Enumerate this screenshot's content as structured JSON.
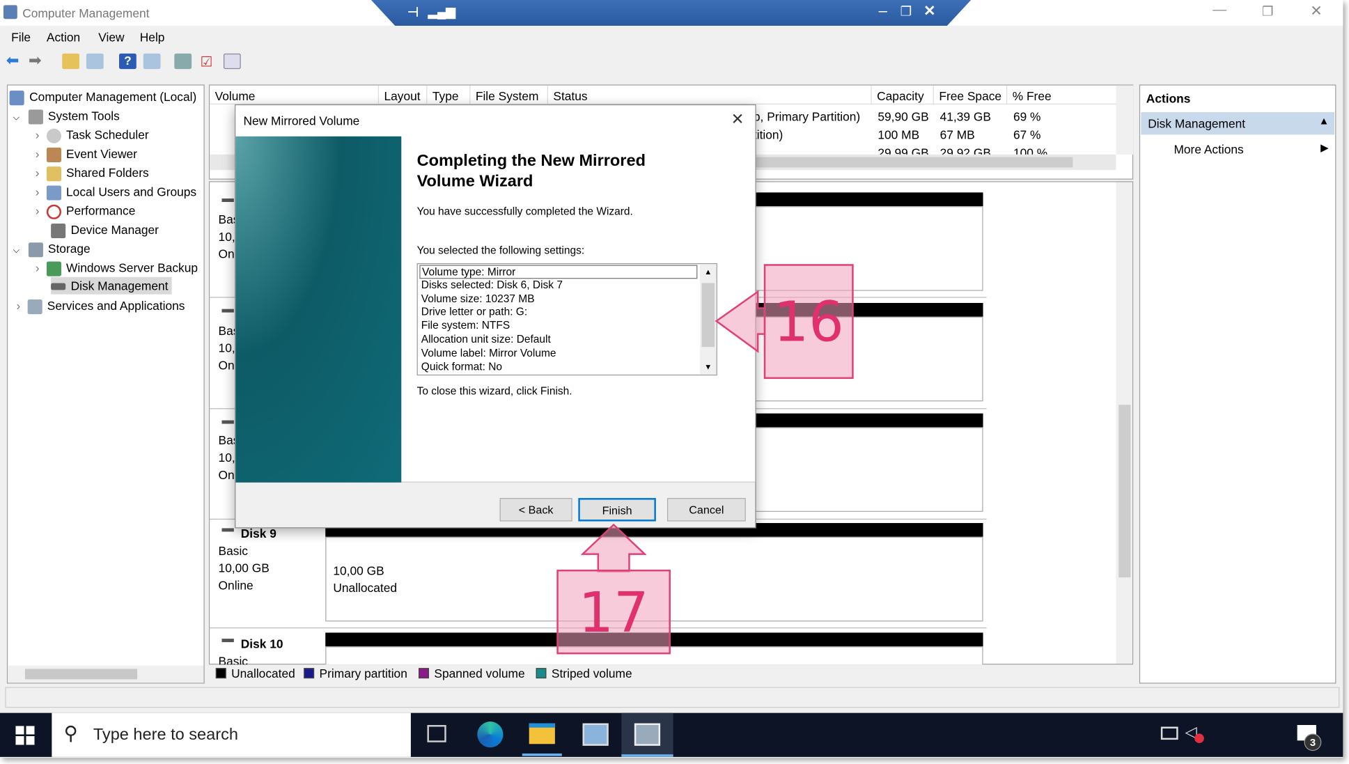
{
  "window": {
    "title": "Computer Management"
  },
  "menu": [
    "File",
    "Action",
    "View",
    "Help"
  ],
  "tree": [
    {
      "label": "Computer Management (Local)",
      "level": 0,
      "icon": "computer-mgmt-icon"
    },
    {
      "label": "System Tools",
      "level": 1,
      "icon": "tools-icon",
      "expanded": true
    },
    {
      "label": "Task Scheduler",
      "level": 2,
      "icon": "clock-icon"
    },
    {
      "label": "Event Viewer",
      "level": 2,
      "icon": "event-viewer-icon"
    },
    {
      "label": "Shared Folders",
      "level": 2,
      "icon": "shared-folder-icon"
    },
    {
      "label": "Local Users and Groups",
      "level": 2,
      "icon": "users-icon"
    },
    {
      "label": "Performance",
      "level": 2,
      "icon": "performance-icon"
    },
    {
      "label": "Device Manager",
      "level": 2,
      "icon": "device-manager-icon"
    },
    {
      "label": "Storage",
      "level": 1,
      "icon": "storage-icon",
      "expanded": true
    },
    {
      "label": "Windows Server Backup",
      "level": 2,
      "icon": "backup-icon"
    },
    {
      "label": "Disk Management",
      "level": 2,
      "icon": "disk-icon",
      "selected": true
    },
    {
      "label": "Services and Applications",
      "level": 1,
      "icon": "services-icon"
    }
  ],
  "volumes": {
    "columns": [
      "Volume",
      "Layout",
      "Type",
      "File System",
      "Status",
      "Capacity",
      "Free Space",
      "% Free"
    ],
    "rows": [
      {
        "status": "p, Primary Partition)",
        "capacity": "59,90 GB",
        "free": "41,39 GB",
        "pct": "69 %"
      },
      {
        "status": "tition)",
        "capacity": "100 MB",
        "free": "67 MB",
        "pct": "67 %"
      },
      {
        "status": "",
        "capacity": "29,99 GB",
        "free": "29,92 GB",
        "pct": "100 %"
      }
    ]
  },
  "disks": [
    {
      "name": "",
      "type": "Bas",
      "size": "10,",
      "state": "On"
    },
    {
      "name": "",
      "type": "Bas",
      "size": "10,",
      "state": "On"
    },
    {
      "name": "",
      "type": "Bas",
      "size": "10,",
      "state": "On"
    },
    {
      "name": "Disk 9",
      "type": "Basic",
      "size": "10,00 GB",
      "state": "Online",
      "part_size": "10,00 GB",
      "part_label": "Unallocated"
    },
    {
      "name": "Disk 10",
      "type": "Basic"
    }
  ],
  "legend": [
    {
      "label": "Unallocated",
      "color": "#000000"
    },
    {
      "label": "Primary partition",
      "color": "#1a1a8c"
    },
    {
      "label": "Spanned volume",
      "color": "#8b1a8b"
    },
    {
      "label": "Striped volume",
      "color": "#1a8b8b"
    }
  ],
  "actions": {
    "header": "Actions",
    "section": "Disk Management",
    "items": [
      "More Actions"
    ]
  },
  "dialog": {
    "title": "New Mirrored Volume",
    "heading": "Completing the New Mirrored Volume Wizard",
    "success": "You have successfully completed the Wizard.",
    "settings_label": "You selected the following settings:",
    "settings": [
      "Volume type: Mirror",
      "Disks selected: Disk 6, Disk 7",
      "Volume size: 10237 MB",
      "Drive letter or path: G:",
      "File system: NTFS",
      "Allocation unit size: Default",
      "Volume label: Mirror Volume",
      "Quick format: No"
    ],
    "close_hint": "To close this wizard, click Finish.",
    "back": "< Back",
    "finish": "Finish",
    "cancel": "Cancel"
  },
  "callouts": [
    "16",
    "17"
  ],
  "taskbar": {
    "search_placeholder": "Type here to search",
    "notification_count": "3"
  }
}
